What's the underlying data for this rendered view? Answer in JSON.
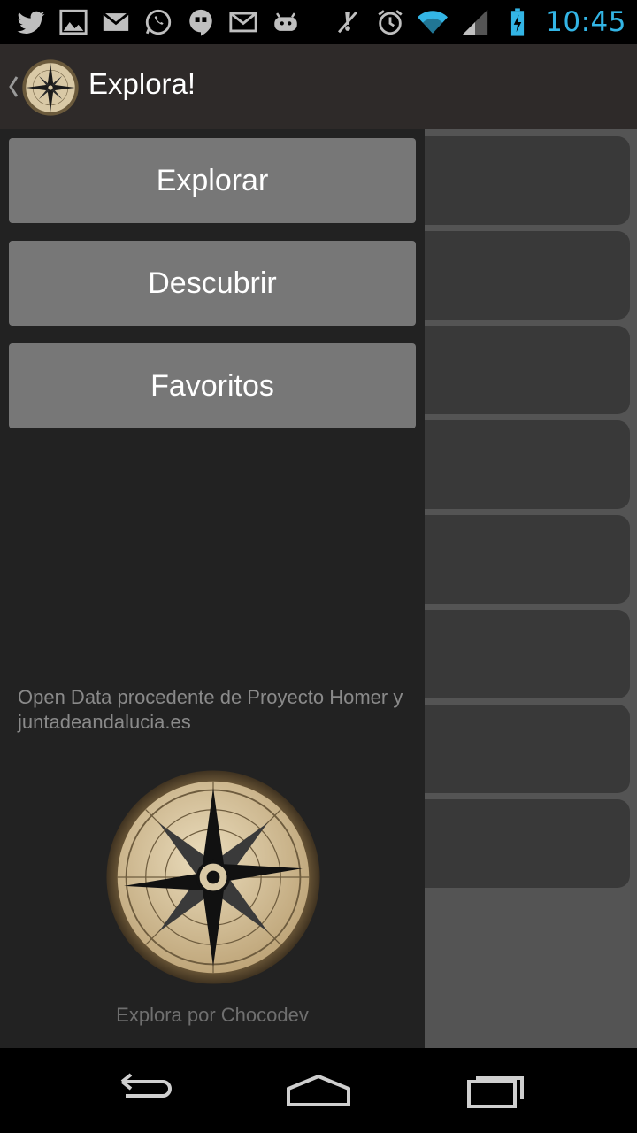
{
  "status_bar": {
    "time": "10:45",
    "left_icons": [
      "twitter-icon",
      "gallery-icon",
      "gmail-icon",
      "whatsapp-icon",
      "hangouts-icon",
      "email-icon",
      "android-icon"
    ],
    "right_icons": [
      "mute-icon",
      "alarm-icon",
      "wifi-icon",
      "signal-icon",
      "battery-charging-icon"
    ]
  },
  "action_bar": {
    "title": "Explora!",
    "logo_icon": "compass-icon",
    "up_icon": "chevron-left-icon"
  },
  "drawer": {
    "menu": [
      {
        "label": "Explorar"
      },
      {
        "label": "Descubrir"
      },
      {
        "label": "Favoritos"
      }
    ],
    "credit": "Open Data procedente de Proyecto Homer y juntadeandalucia.es",
    "footer": "Explora por Chocodev"
  },
  "colors": {
    "action_bar_bg": "#2e2a29",
    "drawer_bg": "#222222",
    "button_bg": "#777777",
    "clock": "#33b5e5"
  },
  "nav_bar": {
    "icons": [
      "back-icon",
      "home-icon",
      "recent-apps-icon"
    ]
  }
}
